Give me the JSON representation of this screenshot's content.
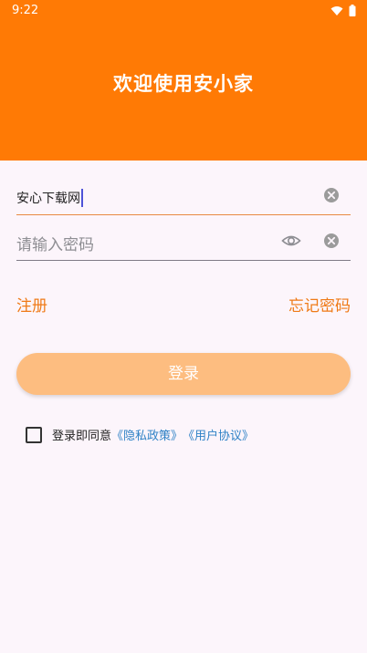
{
  "status_bar": {
    "time": "9:22"
  },
  "header": {
    "title": "欢迎使用安小家"
  },
  "form": {
    "username_value": "安心下载网",
    "password_placeholder": "请输入密码"
  },
  "links": {
    "register": "注册",
    "forgot_password": "忘记密码"
  },
  "login_button": "登录",
  "agreement": {
    "prefix": "登录即同意",
    "privacy_policy": "《隐私政策》",
    "user_agreement": "《用户协议》"
  },
  "colors": {
    "brand": "#ff7a05",
    "link": "#ef7a17",
    "button": "#fdbd80",
    "policy_link": "#2f82c6"
  }
}
